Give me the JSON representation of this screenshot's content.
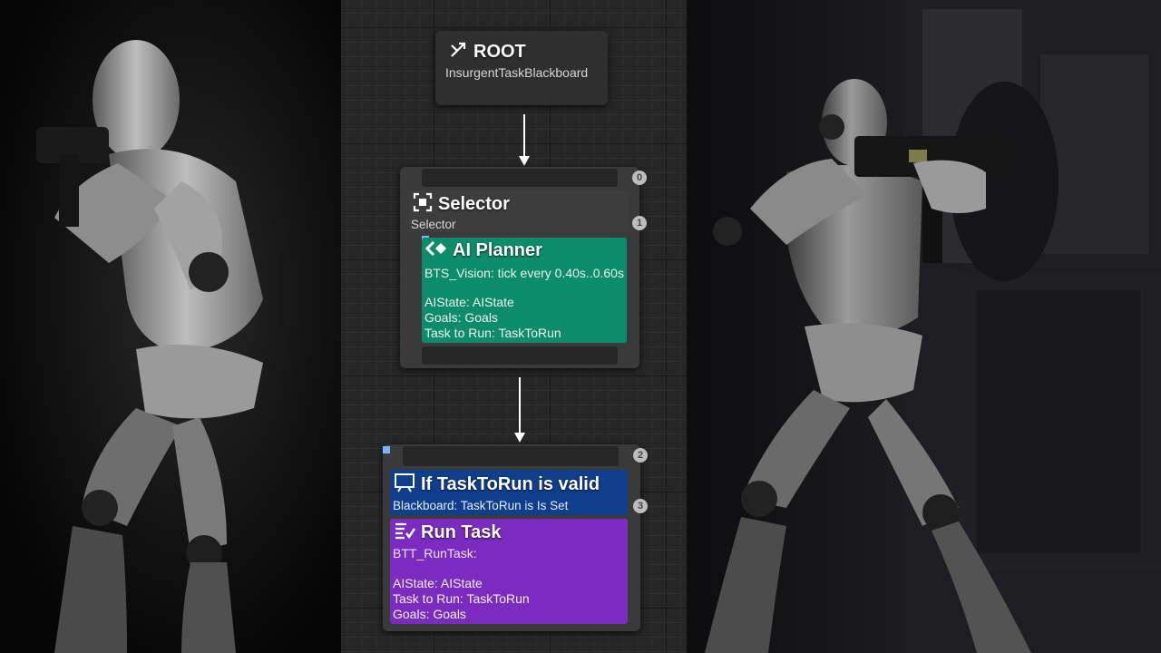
{
  "root_node": {
    "title": "ROOT",
    "subtitle": "InsurgentTaskBlackboard",
    "icon": "root-branch-icon"
  },
  "selector_node": {
    "title": "Selector",
    "subtitle": "Selector",
    "badge_top": "0",
    "badge_mid": "1",
    "icon": "selector-icon"
  },
  "ai_planner": {
    "title": "AI Planner",
    "subtitle": "BTS_Vision: tick every 0.40s..0.60s",
    "lines": [
      "AIState: AIState",
      "Goals: Goals",
      "Task to Run: TaskToRun"
    ],
    "color": "#0d8c6b",
    "icon": "service-icon"
  },
  "runtask_node": {
    "badge_top": "2",
    "badge_mid": "3"
  },
  "decorator": {
    "title": "If TaskToRun is valid",
    "subtitle": "Blackboard: TaskToRun is Is Set",
    "color": "#0f3e8c",
    "icon": "blackboard-decorator-icon"
  },
  "run_task": {
    "title": "Run Task",
    "subtitle": "BTT_RunTask:",
    "lines": [
      "AIState: AIState",
      "Task to Run: TaskToRun",
      "Goals: Goals"
    ],
    "color": "#7b2bbf",
    "icon": "task-icon"
  }
}
